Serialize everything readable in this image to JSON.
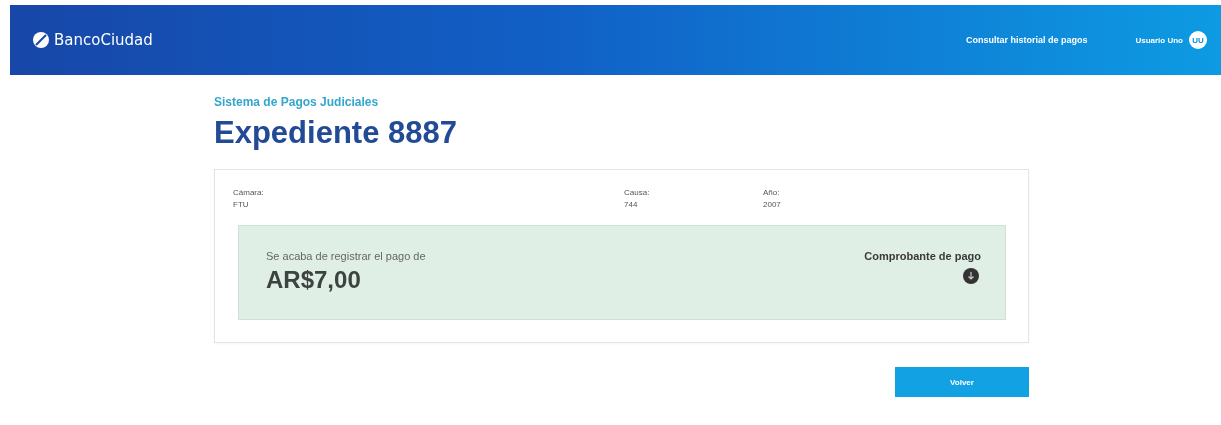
{
  "header": {
    "brand": "BancoCiudad",
    "nav_link": "Consultar historial de pagos",
    "user_name": "Usuario Uno",
    "avatar_initials": "UU"
  },
  "subtitle": "Sistema de Pagos Judiciales",
  "title": "Expediente 8887",
  "details": [
    {
      "label": "Cámara:",
      "value": "FTU"
    },
    {
      "label": "Causa:",
      "value": "744"
    },
    {
      "label": "Año:",
      "value": "2007"
    }
  ],
  "payment": {
    "message": "Se acaba de registrar el pago de",
    "amount": "AR$7,00",
    "receipt_label": "Comprobante de pago"
  },
  "buttons": [
    "Volver"
  ]
}
